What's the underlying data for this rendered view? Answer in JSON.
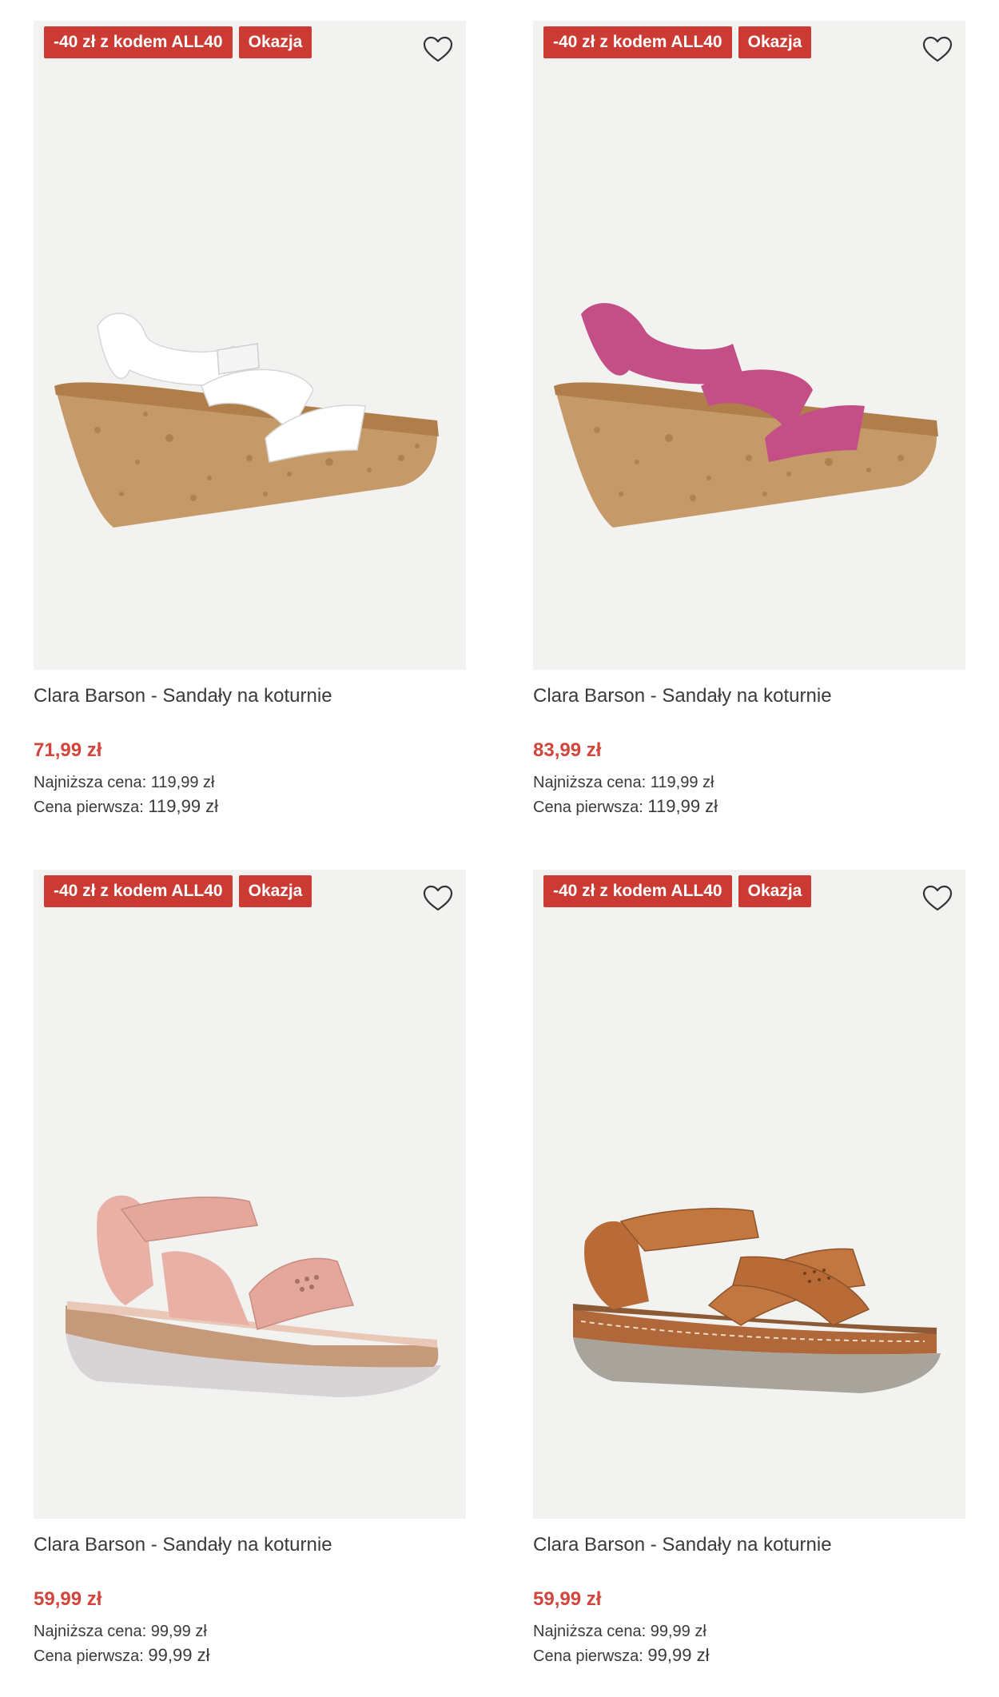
{
  "products": [
    {
      "badge_code": "-40 zł z kodem ALL40",
      "badge_deal": "Okazja",
      "name": "Clara Barson - Sandały na koturnie",
      "price": "71,99 zł",
      "lowest_label": "Najniższa cena:",
      "lowest_value": "119,99 zł",
      "first_label": "Cena pierwsza:",
      "first_value": "119,99 zł",
      "shoe_color": "white",
      "shoe_style": "cork-wedge"
    },
    {
      "badge_code": "-40 zł z kodem ALL40",
      "badge_deal": "Okazja",
      "name": "Clara Barson - Sandały na koturnie",
      "price": "83,99 zł",
      "lowest_label": "Najniższa cena:",
      "lowest_value": "119,99 zł",
      "first_label": "Cena pierwsza:",
      "first_value": "119,99 zł",
      "shoe_color": "pink",
      "shoe_style": "cork-wedge"
    },
    {
      "badge_code": "-40 zł z kodem ALL40",
      "badge_deal": "Okazja",
      "name": "Clara Barson - Sandały na koturnie",
      "price": "59,99 zł",
      "lowest_label": "Najniższa cena:",
      "lowest_value": "99,99 zł",
      "first_label": "Cena pierwsza:",
      "first_value": "99,99 zł",
      "shoe_color": "light-pink",
      "shoe_style": "comfort-wedge"
    },
    {
      "badge_code": "-40 zł z kodem ALL40",
      "badge_deal": "Okazja",
      "name": "Clara Barson - Sandały na koturnie",
      "price": "59,99 zł",
      "lowest_label": "Najniższa cena:",
      "lowest_value": "99,99 zł",
      "first_label": "Cena pierwsza:",
      "first_value": "99,99 zł",
      "shoe_color": "tan",
      "shoe_style": "comfort-flat"
    }
  ],
  "icons": {
    "favorite": "heart-outline-icon"
  },
  "colors": {
    "badge_bg": "#cc3b33",
    "price": "#d2453d",
    "image_bg": "#f2f2f1"
  }
}
